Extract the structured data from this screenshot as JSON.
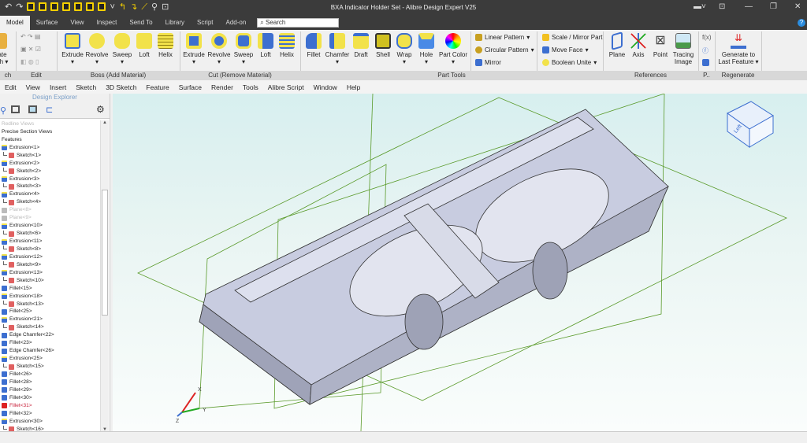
{
  "window": {
    "title": "BXA Indicator Holder Set - Alibre Design Expert V25"
  },
  "tabs": [
    "Model",
    "Surface",
    "View",
    "Inspect",
    "Send To",
    "Library",
    "Script",
    "Add-on"
  ],
  "search": {
    "placeholder": "Search"
  },
  "ribbon": {
    "groups": [
      "ch",
      "Edit",
      "Boss (Add Material)",
      "Cut (Remove Material)",
      "Part Tools",
      "References",
      "P..",
      "Regenerate"
    ],
    "sketch_partial": "ate\nch",
    "boss": [
      "Extrude",
      "Revolve",
      "Sweep",
      "Loft",
      "Helix"
    ],
    "cut": [
      "Extrude",
      "Revolve",
      "Sweep",
      "Loft",
      "Helix"
    ],
    "part_tools": [
      "Fillet",
      "Chamfer",
      "Draft",
      "Shell",
      "Wrap",
      "Hole",
      "Part Color"
    ],
    "patterns": [
      "Linear Pattern",
      "Circular Pattern",
      "Mirror"
    ],
    "modify": [
      "Scale / Mirror Part",
      "Move Face",
      "Boolean Unite"
    ],
    "references": [
      "Plane",
      "Axis",
      "Point",
      "Tracing Image"
    ],
    "regenerate": "Generate to Last Feature"
  },
  "menu": [
    "Edit",
    "View",
    "Insert",
    "Sketch",
    "3D Sketch",
    "Feature",
    "Surface",
    "Render",
    "Tools",
    "Alibre Script",
    "Window",
    "Help"
  ],
  "explorer": {
    "title": "Design Explorer",
    "items": [
      {
        "label": "Redline Views",
        "type": "faded"
      },
      {
        "label": "Precise Section Views",
        "type": "plain"
      },
      {
        "label": "Features",
        "type": "plain"
      },
      {
        "label": "Extrusion<1>",
        "type": "extrusion"
      },
      {
        "label": "Sketch<1>",
        "type": "sketch"
      },
      {
        "label": "Extrusion<2>",
        "type": "extrusion"
      },
      {
        "label": "Sketch<2>",
        "type": "sketch"
      },
      {
        "label": "Extrusion<3>",
        "type": "extrusion"
      },
      {
        "label": "Sketch<3>",
        "type": "sketch"
      },
      {
        "label": "Extrusion<4>",
        "type": "extrusion"
      },
      {
        "label": "Sketch<4>",
        "type": "sketch"
      },
      {
        "label": "Plane<8>",
        "type": "plane"
      },
      {
        "label": "Plane<9>",
        "type": "plane"
      },
      {
        "label": "Extrusion<10>",
        "type": "extrusion"
      },
      {
        "label": "Sketch<6>",
        "type": "sketch"
      },
      {
        "label": "Extrusion<11>",
        "type": "extrusion"
      },
      {
        "label": "Sketch<8>",
        "type": "sketch"
      },
      {
        "label": "Extrusion<12>",
        "type": "extrusion"
      },
      {
        "label": "Sketch<9>",
        "type": "sketch"
      },
      {
        "label": "Extrusion<13>",
        "type": "extrusion"
      },
      {
        "label": "Sketch<10>",
        "type": "sketch"
      },
      {
        "label": "Fillet<15>",
        "type": "fillet"
      },
      {
        "label": "Extrusion<18>",
        "type": "extrusion"
      },
      {
        "label": "Sketch<13>",
        "type": "sketch"
      },
      {
        "label": "Fillet<25>",
        "type": "fillet"
      },
      {
        "label": "Extrusion<21>",
        "type": "extrusion"
      },
      {
        "label": "Sketch<14>",
        "type": "sketch"
      },
      {
        "label": "Edge Chamfer<22>",
        "type": "fillet"
      },
      {
        "label": "Fillet<23>",
        "type": "fillet"
      },
      {
        "label": "Edge Chamfer<26>",
        "type": "fillet"
      },
      {
        "label": "Extrusion<25>",
        "type": "extrusion"
      },
      {
        "label": "Sketch<15>",
        "type": "sketch"
      },
      {
        "label": "Fillet<26>",
        "type": "fillet"
      },
      {
        "label": "Fillet<28>",
        "type": "fillet"
      },
      {
        "label": "Fillet<29>",
        "type": "fillet"
      },
      {
        "label": "Fillet<30>",
        "type": "fillet"
      },
      {
        "label": "Fillet<31>",
        "type": "error"
      },
      {
        "label": "Fillet<32>",
        "type": "fillet"
      },
      {
        "label": "Extrusion<30>",
        "type": "extrusion"
      },
      {
        "label": "Sketch<16>",
        "type": "sketch"
      }
    ]
  },
  "viewcube": {
    "face_label": "Left"
  },
  "triad": {
    "x": "X",
    "y": "Y",
    "z": "Z"
  },
  "colors": {
    "titlebar": "#3b3b3b",
    "accent": "#f5d000",
    "icon_blue": "#3d6fd0",
    "plane_lines": "#5a9a2a",
    "model_face": "#c8cce0"
  }
}
